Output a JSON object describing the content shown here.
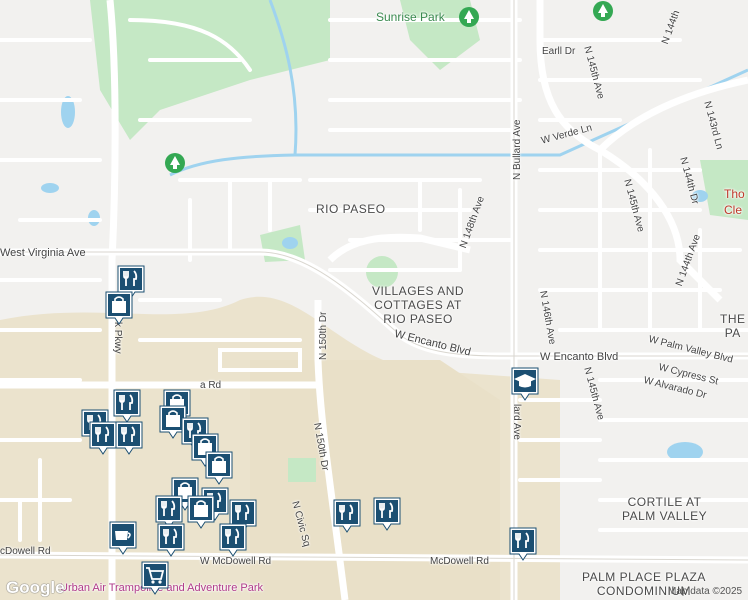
{
  "map": {
    "area_labels": [
      "RIO PASEO",
      "VILLAGES AND\nCOTTAGES AT\nRIO PASEO",
      "CORTILE AT\nPALM VALLEY",
      "PALM PLACE PLAZA\nCONDOMINIUM",
      "THE\nPA"
    ],
    "park_labels": [
      "Sunrise Park",
      "Tho\nCle"
    ],
    "roads": {
      "west_virginia": "West Virginia Ave",
      "w_encanto_1": "W Encanto Blvd",
      "w_encanto_2": "W Encanto Blvd",
      "n_bullard_top": "N Bullard Ave",
      "n_bullard_bottom": "lard Ave",
      "n_148th": "N 148th Ave",
      "n_150th_top": "N 150th Dr",
      "n_150th_bottom": "N 150th Dr",
      "n_civic": "N Civic Sq",
      "mcdowell_left": "cDowell Rd",
      "w_mcdowell": "W McDowell Rd",
      "mcdowell_right": "McDowell Rd",
      "n_146th": "N 146th Ave",
      "n_145th_top": "N 145th Ave",
      "n_145th_mid": "N 145th Ave",
      "n_145th_bot": "N 145th Ave",
      "n_144th_dr": "N 144th Dr",
      "n_144th_ave": "N 144th Ave",
      "n_143rd": "N 143rd Ln",
      "n_144th_top": "N 144th",
      "earll": "Earll Dr",
      "w_verde": "W Verde Ln",
      "w_palm_valley": "W Palm Valley Blvd",
      "w_cypress": "W Cypress St",
      "w_alvarado": "W Alvarado Dr",
      "pkwy": "k Pkwy",
      "a_rd": "a Rd",
      "urban_air": "Urban Air Trampoline and Adventure Park"
    },
    "attribution": "Map data ©2025",
    "logo": "Google",
    "colors": {
      "land": "#f2f1ef",
      "park": "#c5e8c5",
      "water": "#9fd3ef",
      "road": "#ffffff",
      "commercial": "#ebe3cd",
      "pin": "#1b4f72",
      "park_pin": "#34a853"
    }
  }
}
